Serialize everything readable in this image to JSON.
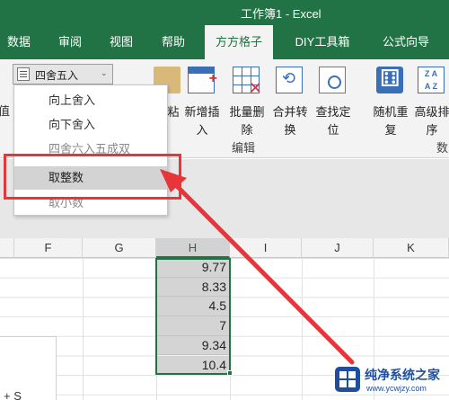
{
  "window": {
    "title": "工作簿1  -  Excel"
  },
  "tabs": [
    {
      "label": "数据",
      "active": false
    },
    {
      "label": "审阅",
      "active": false
    },
    {
      "label": "视图",
      "active": false
    },
    {
      "label": "帮助",
      "active": false
    },
    {
      "label": "方方格子",
      "active": true
    },
    {
      "label": "DIY工具箱",
      "active": false
    },
    {
      "label": "公式向导",
      "active": false
    }
  ],
  "ribbon": {
    "rounding_dropdown": {
      "value": "四舍五入",
      "icon": "rounding-icon"
    },
    "left_cut_label": "值",
    "buttons": [
      {
        "line1": "粘",
        "line2": "",
        "icon": "paste-icon"
      },
      {
        "line1": "新增插",
        "line2": "入",
        "icon": "insert-icon"
      },
      {
        "line1": "批量删",
        "line2": "除",
        "icon": "delete-icon"
      },
      {
        "line1": "合并转",
        "line2": "换",
        "icon": "merge-icon"
      },
      {
        "line1": "查找定",
        "line2": "位",
        "icon": "find-icon"
      },
      {
        "line1": "随机重",
        "line2": "复",
        "icon": "random-icon"
      },
      {
        "line1": "高级排",
        "line2": "序",
        "icon": "sort-icon"
      }
    ],
    "groups": {
      "edit": "编辑",
      "data_cut": "数"
    }
  },
  "dropdown_menu": {
    "items": [
      {
        "label": "向上舍入"
      },
      {
        "label": "向下舍入"
      },
      {
        "label": "四舍六入五成双"
      },
      {
        "label": "取整数",
        "highlighted": true
      },
      {
        "label": "取小数"
      }
    ]
  },
  "sheet": {
    "columns": [
      "F",
      "G",
      "H",
      "I",
      "J",
      "K"
    ],
    "selected_column": "H",
    "h_values": [
      "9.77",
      "8.33",
      "4.5",
      "7",
      "9.34",
      "10.4"
    ],
    "left_panel_text": "+ S"
  },
  "annotation": {
    "color": "#e8353a"
  },
  "watermark": {
    "title": "纯净系统之家",
    "url": "www.ycwjzy.com"
  },
  "colors": {
    "excel_green": "#217346",
    "highlight_red": "#e8353a"
  }
}
